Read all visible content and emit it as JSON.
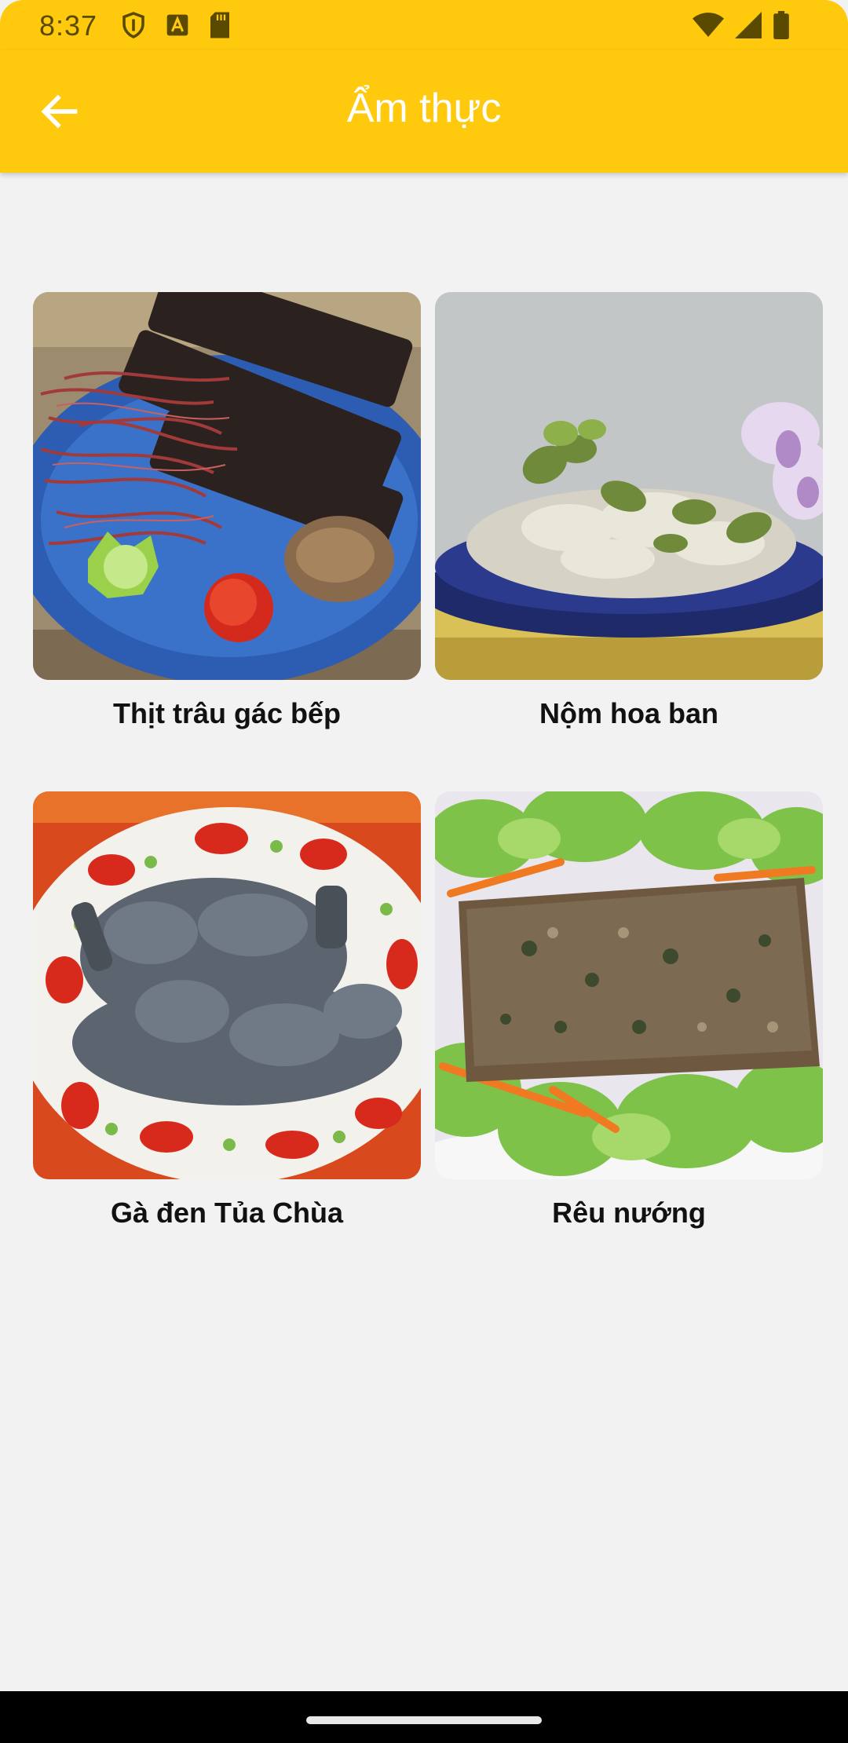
{
  "status_bar": {
    "time": "8:37",
    "icons_left": [
      "shield-icon",
      "a-badge-icon",
      "sd-card-icon"
    ],
    "icons_right": [
      "wifi-icon",
      "signal-icon",
      "battery-icon"
    ]
  },
  "app_bar": {
    "title": "Ẩm thực",
    "back_icon": "arrow-left-icon",
    "color": "#ffc90e"
  },
  "dishes": [
    {
      "name": "Thịt trâu gác bếp"
    },
    {
      "name": "Nộm hoa ban"
    },
    {
      "name": "Gà đen Tủa Chùa"
    },
    {
      "name": "Rêu nướng"
    }
  ]
}
